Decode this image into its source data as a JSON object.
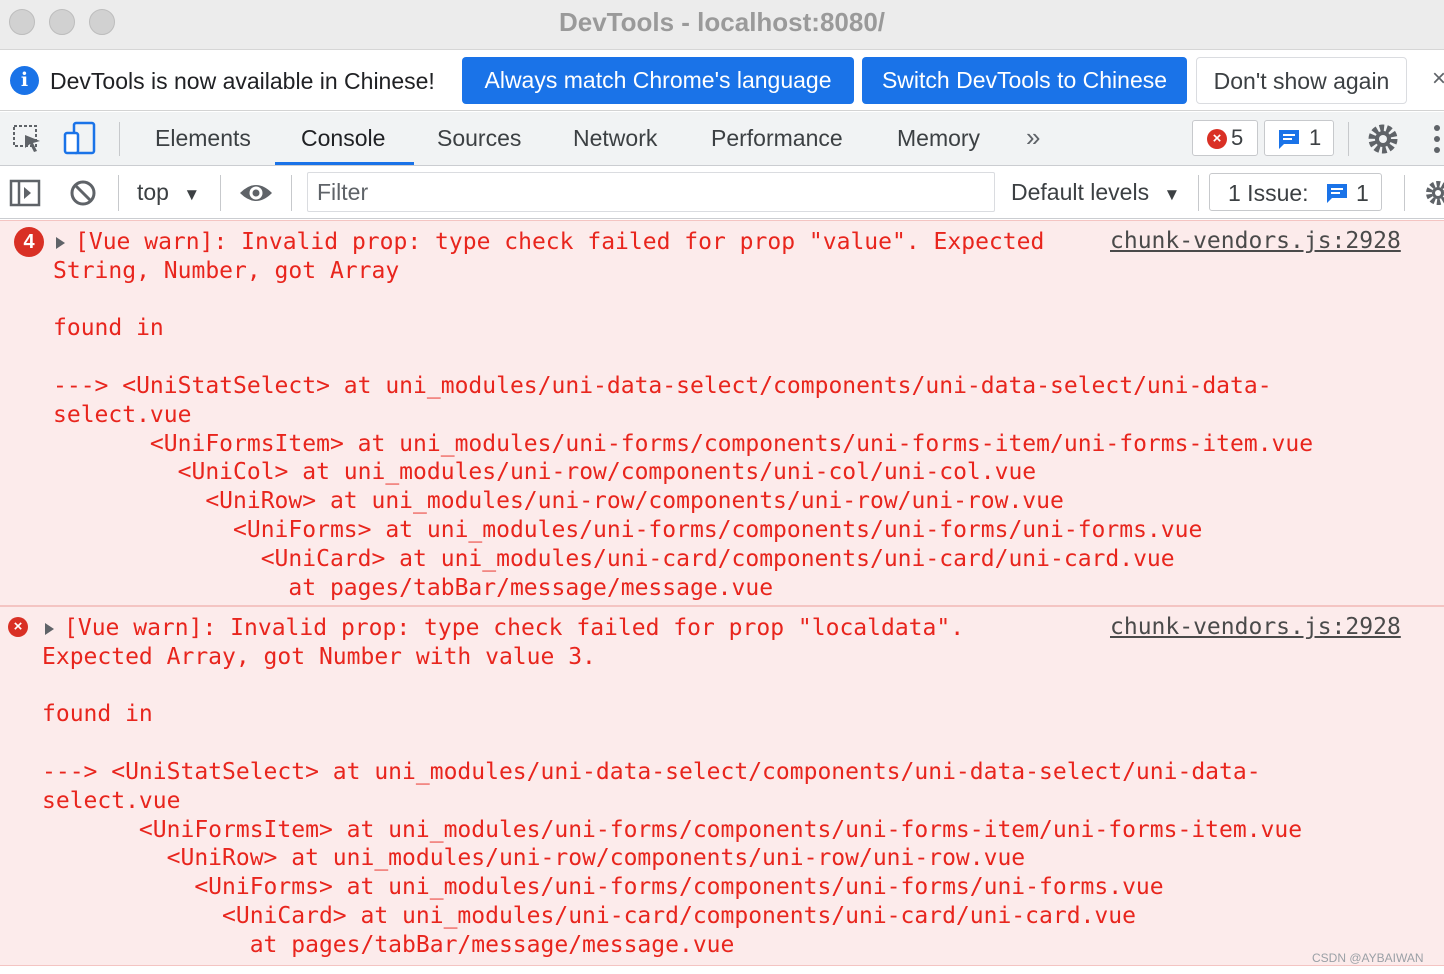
{
  "window": {
    "title": "DevTools - localhost:8080/"
  },
  "infobar": {
    "message": "DevTools is now available in Chinese!",
    "buttons": [
      "Always match Chrome's language",
      "Switch DevTools to Chinese",
      "Don't show again"
    ],
    "close": "×"
  },
  "tabs": {
    "items": [
      "Elements",
      "Console",
      "Sources",
      "Network",
      "Performance",
      "Memory"
    ],
    "active": "Console",
    "more": "»",
    "error_count": "5",
    "message_count": "1"
  },
  "console_toolbar": {
    "context": "top",
    "filter_placeholder": "Filter",
    "levels": "Default levels",
    "issues_label": "1 Issue:",
    "issues_count": "1"
  },
  "messages": [
    {
      "repeat_count": "4",
      "source": "chunk-vendors.js:2928",
      "lines": [
        "[Vue warn]: Invalid prop: type check failed for prop \"value\". Expected",
        "String, Number, got Array",
        "",
        "found in",
        "",
        "---> <UniStatSelect> at uni_modules/uni-data-select/components/uni-data-select/uni-data-",
        "select.vue",
        "       <UniFormsItem> at uni_modules/uni-forms/components/uni-forms-item/uni-forms-item.vue",
        "         <UniCol> at uni_modules/uni-row/components/uni-col/uni-col.vue",
        "           <UniRow> at uni_modules/uni-row/components/uni-row/uni-row.vue",
        "             <UniForms> at uni_modules/uni-forms/components/uni-forms/uni-forms.vue",
        "               <UniCard> at uni_modules/uni-card/components/uni-card/uni-card.vue",
        "                 at pages/tabBar/message/message.vue"
      ]
    },
    {
      "repeat_count": "",
      "source": "chunk-vendors.js:2928",
      "lines": [
        "[Vue warn]: Invalid prop: type check failed for prop \"localdata\".",
        "Expected Array, got Number with value 3.",
        "",
        "found in",
        "",
        "---> <UniStatSelect> at uni_modules/uni-data-select/components/uni-data-select/uni-data-",
        "select.vue",
        "       <UniFormsItem> at uni_modules/uni-forms/components/uni-forms-item/uni-forms-item.vue",
        "         <UniRow> at uni_modules/uni-row/components/uni-row/uni-row.vue",
        "           <UniForms> at uni_modules/uni-forms/components/uni-forms/uni-forms.vue",
        "             <UniCard> at uni_modules/uni-card/components/uni-card/uni-card.vue",
        "               at pages/tabBar/message/message.vue"
      ]
    }
  ],
  "watermark": "CSDN @AYBAIWAN",
  "colors": {
    "accent": "#1a73e8",
    "error": "#d93025",
    "error_text": "#e8251d",
    "error_bg": "#fcebeb"
  }
}
